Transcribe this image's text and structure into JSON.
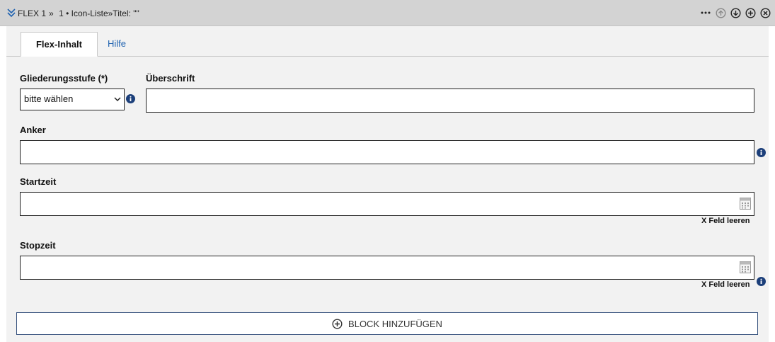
{
  "header": {
    "title": "FLEX 1",
    "separator": "»",
    "subtitle": "1 • Icon-Liste»Titel: \"\"",
    "actions": [
      "more-dots",
      "move-up",
      "move-down",
      "add",
      "close"
    ]
  },
  "tabs": [
    {
      "label": "Flex-Inhalt",
      "active": true
    },
    {
      "label": "Hilfe",
      "active": false
    }
  ],
  "form": {
    "gliederung": {
      "label": "Gliederungsstufe (*)",
      "value": "bitte wählen"
    },
    "ueberschrift": {
      "label": "Überschrift",
      "value": ""
    },
    "anker": {
      "label": "Anker",
      "value": ""
    },
    "startzeit": {
      "label": "Startzeit",
      "value": "",
      "clear": "X Feld leeren"
    },
    "stopzeit": {
      "label": "Stopzeit",
      "value": "",
      "clear": "X Feld leeren"
    }
  },
  "add_block": {
    "label": "BLOCK HINZUFÜGEN"
  },
  "colors": {
    "accent": "#1f62b0",
    "header_bg": "#d3d3d3",
    "content_bg": "#f2f2f2",
    "info_icon": "#1c3f7a"
  }
}
